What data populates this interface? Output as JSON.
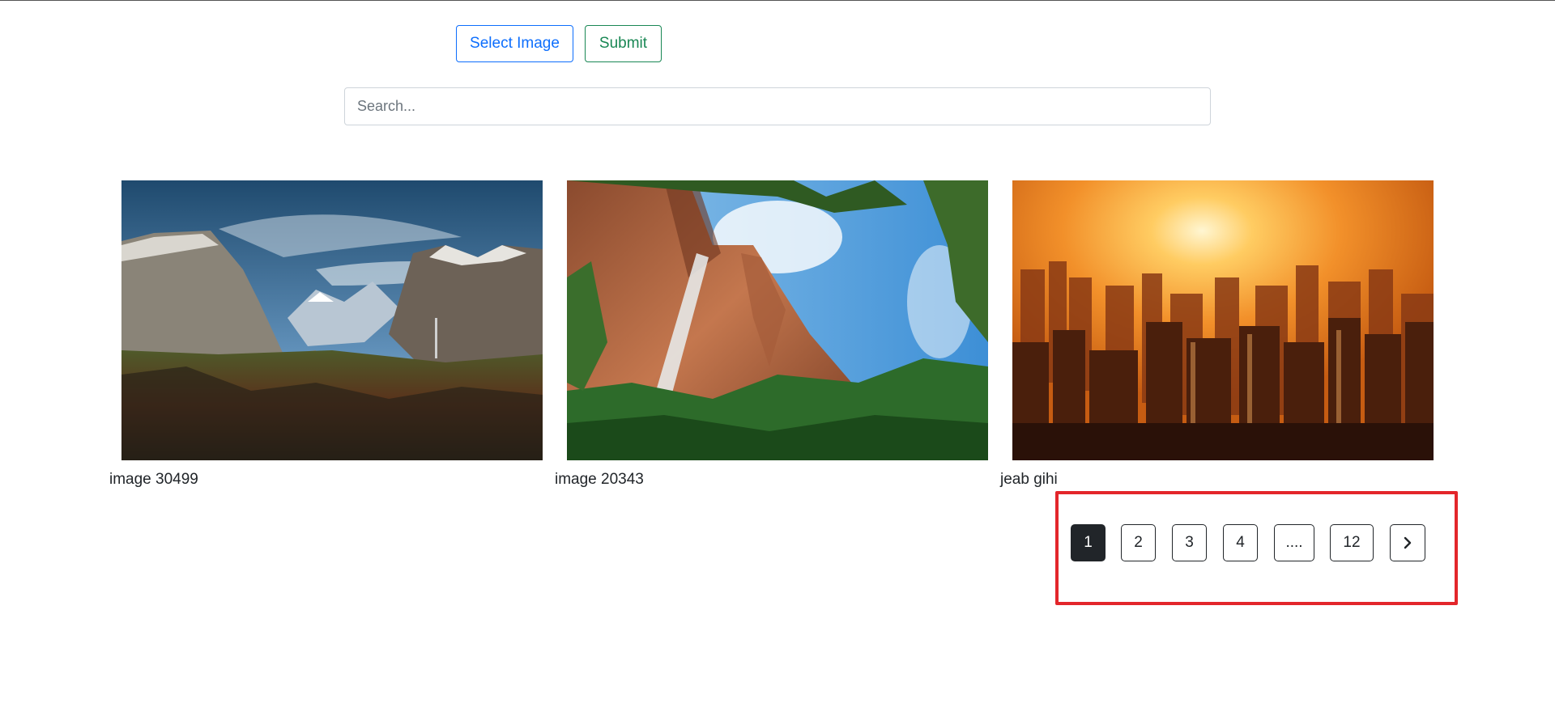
{
  "toolbar": {
    "select_image_label": "Select Image",
    "submit_label": "Submit"
  },
  "search": {
    "placeholder": "Search...",
    "value": ""
  },
  "gallery": {
    "items": [
      {
        "caption": "image 30499",
        "image": "mountain-valley-landscape"
      },
      {
        "caption": "image 20343",
        "image": "red-cliff-waterfall"
      },
      {
        "caption": "jeab gihi",
        "image": "city-sunset-skyline"
      }
    ]
  },
  "pagination": {
    "pages": [
      "1",
      "2",
      "3",
      "4",
      "....",
      "12"
    ],
    "current": "1",
    "next_icon": "chevron-right-icon"
  },
  "colors": {
    "primary": "#0d6efd",
    "success": "#198754",
    "active_page": "#212529",
    "highlight": "#e3262b"
  }
}
